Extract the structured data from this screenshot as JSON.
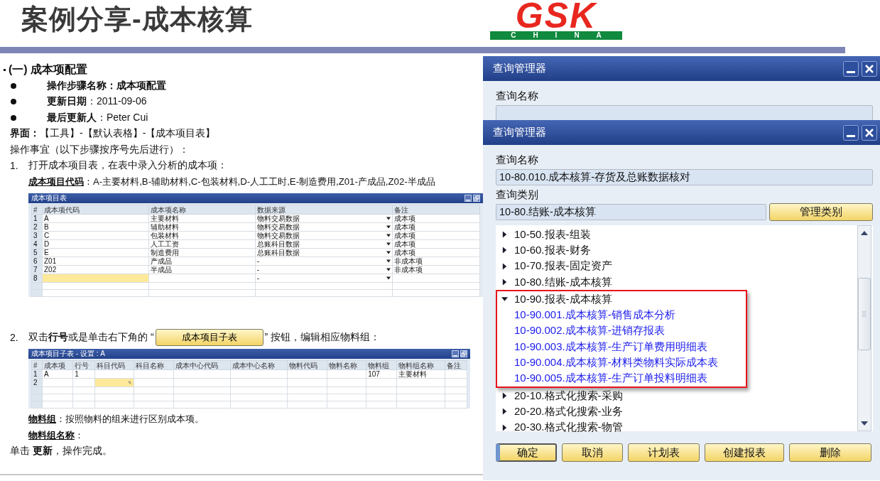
{
  "slide": {
    "title": "案例分享-成本核算",
    "logo": {
      "main": "GSK",
      "sub": "CHINA"
    }
  },
  "document": {
    "blocks": [
      {
        "kind": "heading",
        "text": "(一)  成本项配置"
      },
      {
        "kind": "bullet",
        "text": "操作步骤名称：成本项配置",
        "bold": true
      },
      {
        "kind": "bullet",
        "text": "**更新日期**：2011-09-06",
        "bold": false
      },
      {
        "kind": "bullet",
        "text": "**最后更新人**：Peter Cui",
        "bold": false
      },
      {
        "kind": "para",
        "text": "**界面：**【工具】-【默认表格】-【成本项目表】"
      },
      {
        "kind": "para",
        "text": "操作事宜（以下步骤按序号先后进行）："
      },
      {
        "kind": "step",
        "num": "1.",
        "text": "打开成本项目表，在表中录入分析的成本项："
      },
      {
        "kind": "definition",
        "term": "成本项目代码",
        "text": "：A-主要材料,B-辅助材料,C-包装材料,D-人工工时,E-制造费用,Z01-产成品,Z02-半成品"
      },
      {
        "kind": "table",
        "title": "成本项目表",
        "number_header": "#",
        "columns": [
          {
            "label": "成本项代码",
            "kind": "text"
          },
          {
            "label": "成本项名称",
            "kind": "text"
          },
          {
            "label": "数据来源",
            "kind": "dropdown"
          },
          {
            "label": "备注",
            "kind": "text"
          }
        ],
        "rows": [
          {
            "num": "1",
            "cells": [
              {
                "text": "A",
                "focused": false
              },
              {
                "text": "主要材料",
                "focused": false
              },
              {
                "text": "物料交易数据",
                "focused": false
              },
              {
                "text": "成本项",
                "focused": false
              }
            ]
          },
          {
            "num": "2",
            "cells": [
              {
                "text": "B",
                "focused": false
              },
              {
                "text": "辅助材料",
                "focused": false
              },
              {
                "text": "物料交易数据",
                "focused": false
              },
              {
                "text": "成本项",
                "focused": false
              }
            ]
          },
          {
            "num": "3",
            "cells": [
              {
                "text": "C",
                "focused": false
              },
              {
                "text": "包装材料",
                "focused": false
              },
              {
                "text": "物料交易数据",
                "focused": false
              },
              {
                "text": "成本项",
                "focused": false
              }
            ]
          },
          {
            "num": "4",
            "cells": [
              {
                "text": "D",
                "focused": false
              },
              {
                "text": "人工工资",
                "focused": false
              },
              {
                "text": "总账科目数据",
                "focused": false
              },
              {
                "text": "成本项",
                "focused": false
              }
            ]
          },
          {
            "num": "5",
            "cells": [
              {
                "text": "E",
                "focused": false
              },
              {
                "text": "制造费用",
                "focused": false
              },
              {
                "text": "总账科目数据",
                "focused": false
              },
              {
                "text": "成本项",
                "focused": false
              }
            ]
          },
          {
            "num": "6",
            "cells": [
              {
                "text": "Z01",
                "focused": false
              },
              {
                "text": "产成品",
                "focused": false
              },
              {
                "text": "-",
                "focused": false
              },
              {
                "text": "非成本项",
                "focused": false
              }
            ]
          },
          {
            "num": "7",
            "cells": [
              {
                "text": "Z02",
                "focused": false
              },
              {
                "text": "半成品",
                "focused": false
              },
              {
                "text": "-",
                "focused": false
              },
              {
                "text": "非成本项",
                "focused": false
              }
            ]
          },
          {
            "num": "8",
            "cells": [
              {
                "focused": true
              },
              {
                "focused": false
              },
              {
                "text": "-",
                "focused": false
              },
              {
                "focused": false
              }
            ]
          }
        ]
      },
      {
        "kind": "step_button",
        "num": "2.",
        "before": "双击**行号**或是单击右下角的 “",
        "button": "成本项目子表",
        "after": "” 按钮，编辑相应物料组："
      },
      {
        "kind": "table",
        "title": "成本项目子表 - 设置 : A",
        "number_header": "#",
        "columns": [
          {
            "label": "成本项",
            "kind": "text"
          },
          {
            "label": "行号",
            "kind": "text"
          },
          {
            "label": "科目代码",
            "kind": "lookup"
          },
          {
            "label": "科目名称",
            "kind": "text"
          },
          {
            "label": "成本中心代码",
            "kind": "text"
          },
          {
            "label": "成本中心名称",
            "kind": "text"
          },
          {
            "label": "物料代码",
            "kind": "text"
          },
          {
            "label": "物料名称",
            "kind": "text"
          },
          {
            "label": "物料组",
            "kind": "text"
          },
          {
            "label": "物料组名称",
            "kind": "text"
          },
          {
            "label": "备注",
            "kind": "text"
          }
        ],
        "rows": [
          {
            "num": "1",
            "cells": [
              {
                "text": "A",
                "focused": false
              },
              {
                "text": "1",
                "focused": false
              },
              {
                "focused": false
              },
              {
                "focused": false
              },
              {
                "focused": false
              },
              {
                "focused": false
              },
              {
                "focused": false
              },
              {
                "focused": false
              },
              {
                "text": "107",
                "focused": false
              },
              {
                "text": "主要材料",
                "focused": false
              },
              {
                "focused": false
              }
            ]
          },
          {
            "num": "2",
            "cells": [
              {
                "focused": false
              },
              {
                "focused": false
              },
              {
                "focused": true
              },
              {
                "focused": false
              },
              {
                "focused": false
              },
              {
                "focused": false
              },
              {
                "focused": false
              },
              {
                "focused": false
              },
              {
                "focused": false
              },
              {
                "focused": false
              },
              {
                "focused": false
              }
            ]
          }
        ]
      },
      {
        "kind": "definition",
        "term": "物料组",
        "text": "：按照物料的组来进行区别成本项。"
      },
      {
        "kind": "definition",
        "term": "物料组名称",
        "text": "："
      },
      {
        "kind": "para",
        "text": "单击 **更新**，操作完成。"
      }
    ]
  },
  "back_window": {
    "title": "查询管理器",
    "label": "查询名称"
  },
  "query_manager": {
    "title": "查询管理器",
    "name_label": "查询名称",
    "name_value": "10-80.010.成本核算-存货及总账数据核对",
    "category_label": "查询类别",
    "category_value": "10-80.结账-成本核算",
    "manage_button": "管理类别",
    "tree": [
      {
        "label": "10-50.报表-组装",
        "expanded": false,
        "highlighted": false
      },
      {
        "label": "10-60.报表-财务",
        "expanded": false,
        "highlighted": false
      },
      {
        "label": "10-70.报表-固定资产",
        "expanded": false,
        "highlighted": false
      },
      {
        "label": "10-80.结账-成本核算",
        "expanded": false,
        "highlighted": false
      },
      {
        "label": "10-90.报表-成本核算",
        "expanded": true,
        "highlighted": true,
        "children": [
          {
            "label": "10-90.001.成本核算-销售成本分析"
          },
          {
            "label": "10-90.002.成本核算-进销存报表"
          },
          {
            "label": "10-90.003.成本核算-生产订单费用明细表"
          },
          {
            "label": "10-90.004.成本核算-材料类物料实际成本表"
          },
          {
            "label": "10-90.005.成本核算-生产订单投料明细表"
          }
        ]
      },
      {
        "label": "20-10.格式化搜索-采购",
        "expanded": false,
        "highlighted": false
      },
      {
        "label": "20-20.格式化搜索-业务",
        "expanded": false,
        "highlighted": false
      },
      {
        "label": "20-30.格式化搜索-物管",
        "expanded": false,
        "highlighted": false
      }
    ],
    "buttons": [
      {
        "label": "确定",
        "default": true
      },
      {
        "label": "取消",
        "default": false
      },
      {
        "label": "计划表",
        "default": false
      },
      {
        "label": "创建报表",
        "default": false
      },
      {
        "label": "删除",
        "default": false
      }
    ]
  }
}
